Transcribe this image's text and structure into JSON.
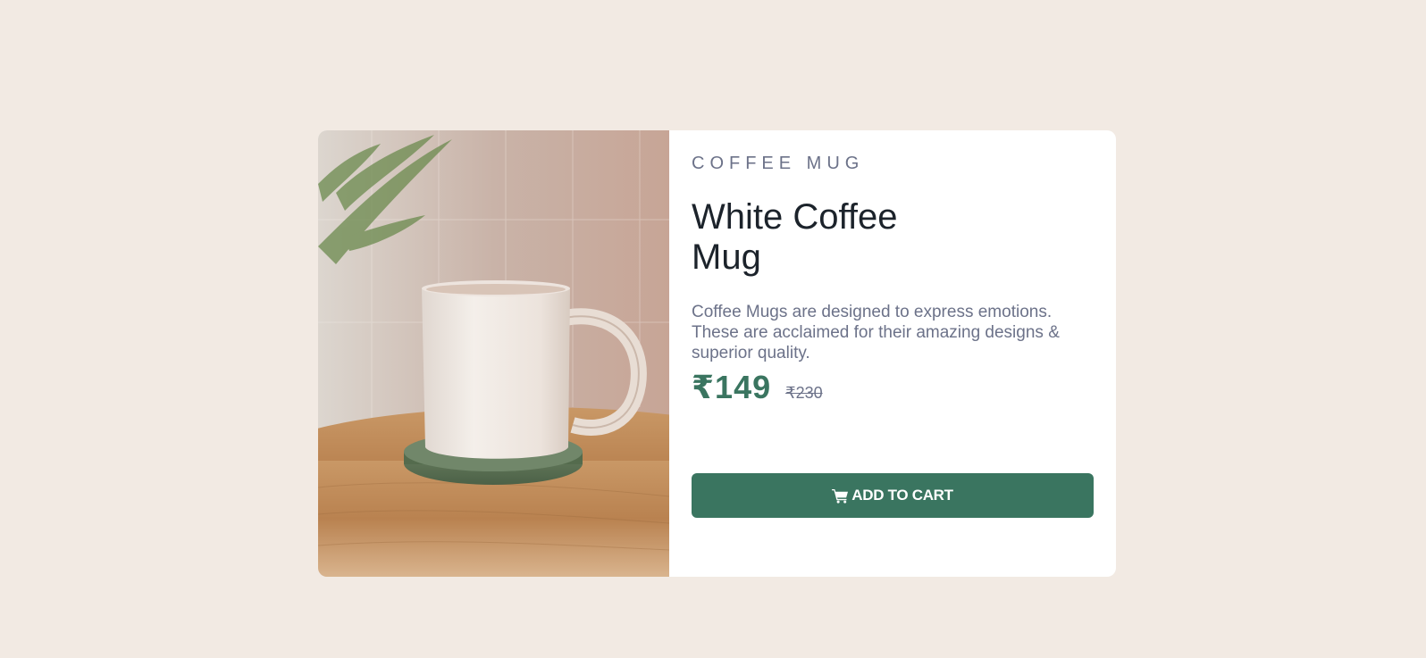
{
  "product": {
    "category": "COFFEE MUG",
    "title": "White Coffee Mug",
    "description": "Coffee Mugs are designed to express emotions. These are acclaimed for their amazing designs & superior quality.",
    "price": "₹149",
    "original_price": "₹230",
    "image_icon": "product-photo-coffee-mug"
  },
  "cart_button": {
    "label": "ADD TO CART",
    "icon": "cart-icon"
  },
  "colors": {
    "page_background": "#f2eae3",
    "accent": "#3a7560",
    "muted_text": "#6c7289"
  }
}
